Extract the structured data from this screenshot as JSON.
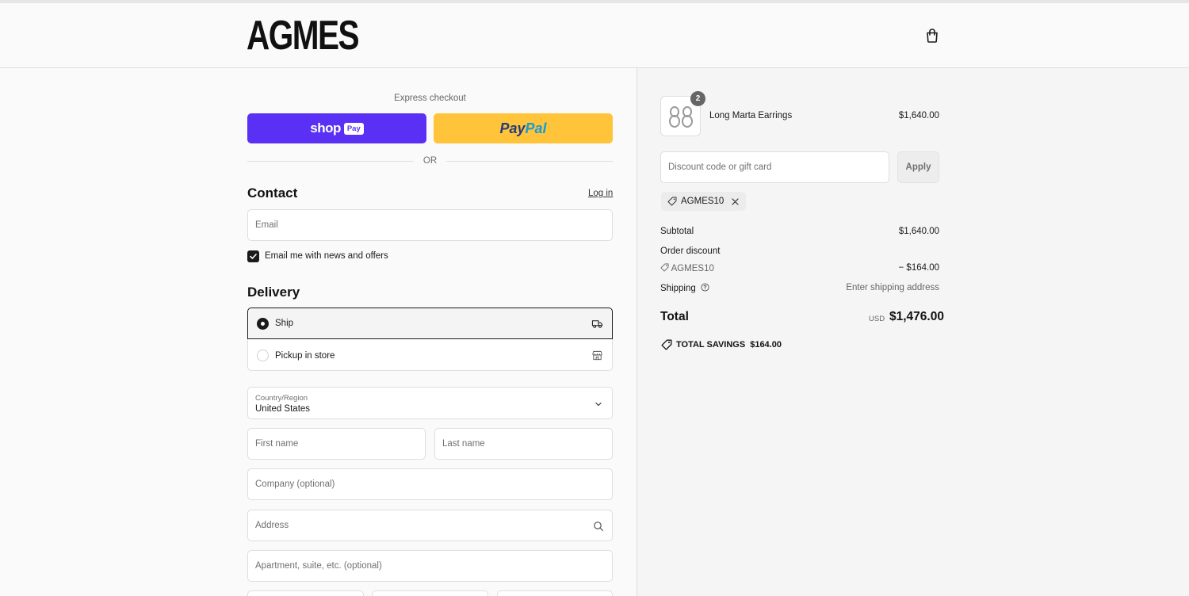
{
  "brand": {
    "logo_text": "AGMES"
  },
  "header": {
    "cart_icon": "shopping-bag-icon"
  },
  "express": {
    "label": "Express checkout",
    "shoppay_word": "shop",
    "shoppay_pay": "Pay",
    "paypal_part1": "Pay",
    "paypal_part2": "Pal",
    "or_text": "OR"
  },
  "contact": {
    "title": "Contact",
    "login_link": "Log in",
    "email_placeholder": "Email",
    "newsletter_label": "Email me with news and offers",
    "newsletter_checked": true
  },
  "delivery": {
    "title": "Delivery",
    "options": [
      {
        "label": "Ship",
        "selected": true,
        "icon": "truck-icon"
      },
      {
        "label": "Pickup in store",
        "selected": false,
        "icon": "store-icon"
      }
    ],
    "country_label": "Country/Region",
    "country_value": "United States",
    "first_name_placeholder": "First name",
    "last_name_placeholder": "Last name",
    "company_placeholder": "Company (optional)",
    "address_placeholder": "Address",
    "apartment_placeholder": "Apartment, suite, etc. (optional)"
  },
  "order": {
    "item": {
      "name": "Long Marta Earrings",
      "price": "$1,640.00",
      "quantity": "2"
    },
    "discount_placeholder": "Discount code or gift card",
    "apply_label": "Apply",
    "applied_code": "AGMES10",
    "subtotal_label": "Subtotal",
    "subtotal_value": "$1,640.00",
    "order_discount_label": "Order discount",
    "discount_code": "AGMES10",
    "discount_value": "− $164.00",
    "shipping_label": "Shipping",
    "shipping_value": "Enter shipping address",
    "total_label": "Total",
    "total_currency": "USD",
    "total_value": "$1,476.00",
    "savings_label": "TOTAL SAVINGS",
    "savings_value": "$164.00"
  },
  "colors": {
    "shoppay": "#5a31f4",
    "paypal": "#ffc439",
    "text": "#1a1a1a",
    "border": "#dedede"
  }
}
